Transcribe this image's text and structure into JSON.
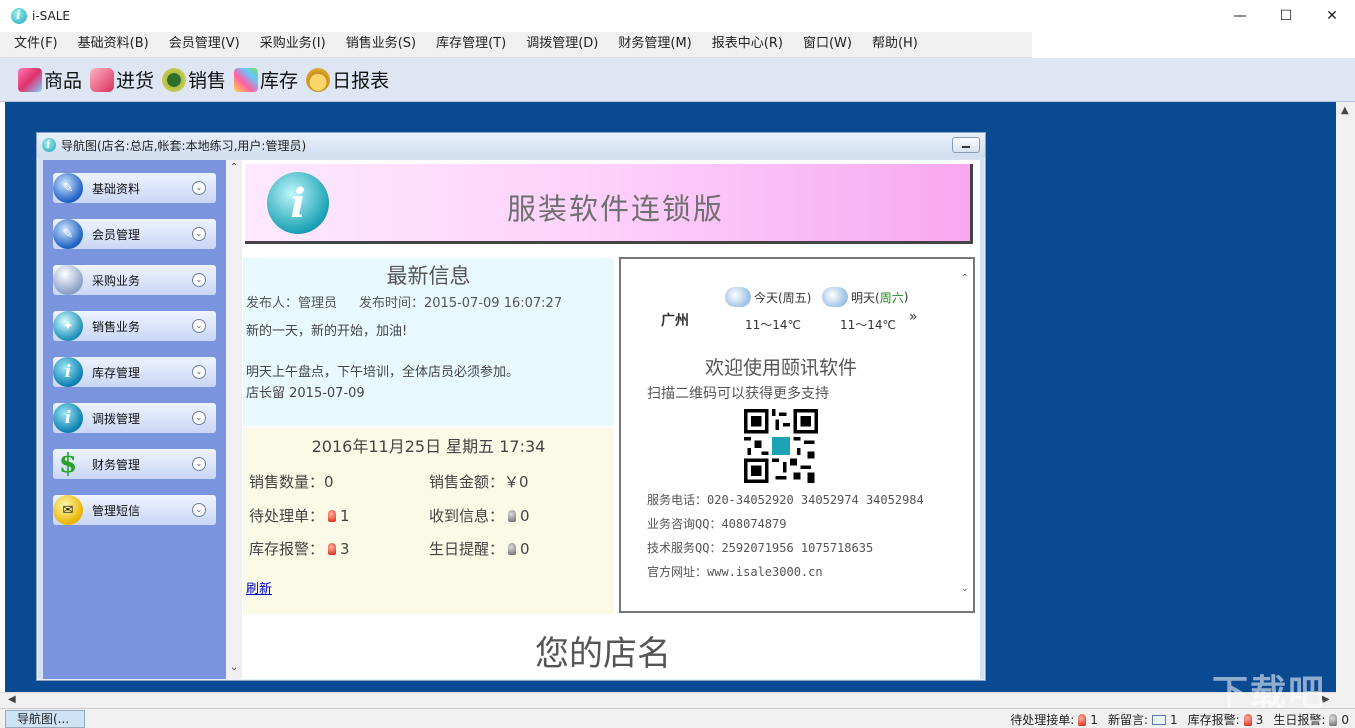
{
  "window": {
    "title": "i-SALE",
    "minimize": "—",
    "maximize": "☐",
    "close": "✕"
  },
  "menu": [
    "文件(F)",
    "基础资料(B)",
    "会员管理(V)",
    "采购业务(I)",
    "销售业务(S)",
    "库存管理(T)",
    "调拨管理(D)",
    "财务管理(M)",
    "报表中心(R)",
    "窗口(W)",
    "帮助(H)"
  ],
  "toolbar": {
    "goods": "商品",
    "purchase": "进货",
    "sales": "销售",
    "stock": "库存",
    "daily": "日报表"
  },
  "nav": {
    "title": "导航图(店名:总店,帐套:本地练习,用户:管理员)",
    "items": [
      "基础资料",
      "会员管理",
      "采购业务",
      "销售业务",
      "库存管理",
      "调拨管理",
      "财务管理",
      "管理短信"
    ],
    "icons": [
      "pen-globe-icon",
      "pen-globe-icon",
      "globe-icon",
      "compass-icon",
      "info-icon",
      "info-icon",
      "dollar-icon",
      "sms-icon"
    ],
    "chevron": "⌄"
  },
  "banner": {
    "title": "服装软件连锁版",
    "icon": "i"
  },
  "news": {
    "heading": "最新信息",
    "publisher_label": "发布人：管理员",
    "time_label": "发布时间：2015-07-09 16:07:27",
    "line1": "新的一天，新的开始，加油!",
    "line2": "明天上午盘点，下午培训，全体店员必须参加。",
    "line3": "店长留 2015-07-09"
  },
  "stats": {
    "datetime": "2016年11月25日 星期五 17:34",
    "sales_qty_label": "销售数量：0",
    "sales_amt_label": "销售金额：￥0",
    "pending_label": "待处理单：",
    "pending_value": "1",
    "received_label": "收到信息：",
    "received_value": "0",
    "stock_alarm_label": "库存报警：",
    "stock_alarm_value": "3",
    "birthday_label": "生日提醒：",
    "birthday_value": "0",
    "refresh": "刷新"
  },
  "welcome": {
    "city": "广州",
    "today_label": "今天(周五)",
    "today_temp": "11～14℃",
    "tomorrow_prefix": "明天(",
    "tomorrow_day": "周六",
    "tomorrow_suffix": ")",
    "tomorrow_temp": "11～14℃",
    "more": "»",
    "title": "欢迎使用颐讯软件",
    "subtitle": "扫描二维码可以获得更多支持",
    "phone": "服务电话：020-34052920 34052974 34052984",
    "qq_business": "业务咨询QQ：408074879",
    "qq_tech": "技术服务QQ：2592071956 1075718635",
    "website": "官方网址：www.isale3000.cn"
  },
  "shop_name": "您的店名",
  "statusbar": {
    "task": "导航图(...",
    "pending_label": "待处理接单:",
    "pending_value": "1",
    "msg_label": "新留言:",
    "msg_value": "1",
    "stock_label": "库存报警:",
    "stock_value": "3",
    "birthday_label": "生日报警:",
    "birthday_value": "0"
  },
  "watermark": "下载吧"
}
